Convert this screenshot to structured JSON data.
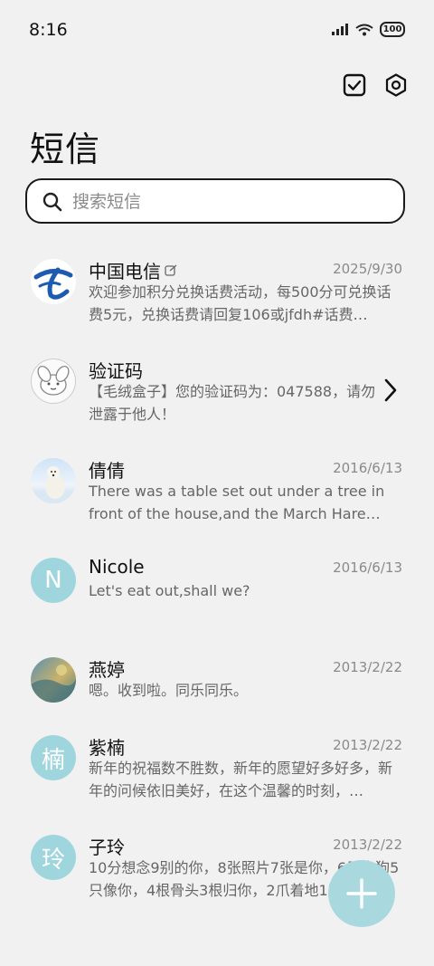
{
  "status": {
    "time": "8:16",
    "battery": "100"
  },
  "page": {
    "title": "短信"
  },
  "search": {
    "placeholder": "搜索短信"
  },
  "messages": [
    {
      "name": "中国电信",
      "date": "2025/9/30",
      "preview": "欢迎参加积分兑换话费活动，每500分可兑换话费5元，兑换话费请回复106或jfdh#话费…"
    },
    {
      "name": "验证码",
      "date": "",
      "preview": "【毛绒盒子】您的验证码为：047588，请勿泄露于他人！"
    },
    {
      "name": "倩倩",
      "date": "2016/6/13",
      "preview": "There was a table set out under a tree in front of the house,and the March Hare an…"
    },
    {
      "name": "Nicole",
      "avatar_letter": "N",
      "date": "2016/6/13",
      "preview": "Let's eat out,shall we?"
    },
    {
      "name": "燕婷",
      "date": "2013/2/22",
      "preview": "嗯。收到啦。同乐同乐。"
    },
    {
      "name": "紫楠",
      "avatar_letter": "楠",
      "date": "2013/2/22",
      "preview": "新年的祝福数不胜数，新年的愿望好多好多，新年的问候依旧美好，在这个温馨的时刻，…"
    },
    {
      "name": "子玲",
      "avatar_letter": "玲",
      "date": "2013/2/22",
      "preview": "10分想念9别的你，8张照片7张是你，6只小狗5只像你，4根骨头3根归你，2爪着地1定…"
    }
  ],
  "colors": {
    "accent": "#a9d9df",
    "avatar_letter_bg": "#9fd6dd",
    "telecom_blue": "#1d5bb0"
  },
  "icons": {
    "toolbar": [
      "check-square-icon",
      "settings-hexagon-icon"
    ],
    "fab": "plus-icon"
  }
}
